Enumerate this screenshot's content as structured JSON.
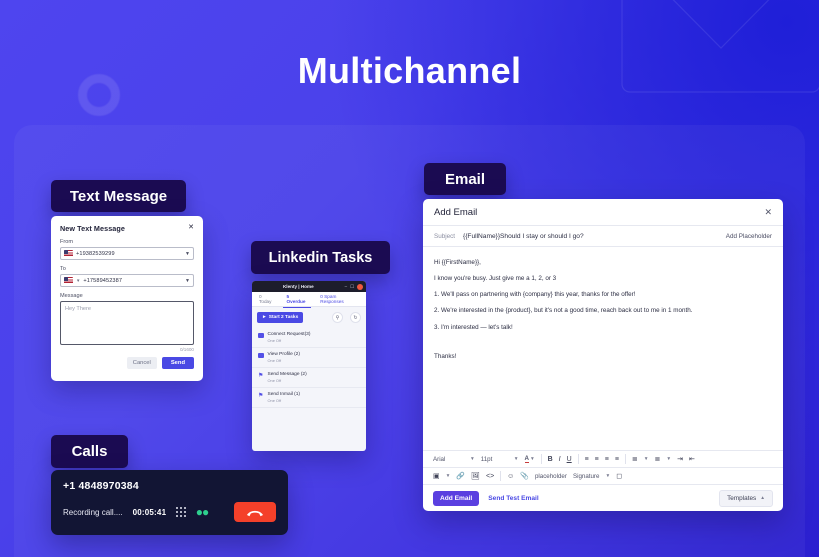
{
  "headline": "Multichannel",
  "tags": {
    "text_message": "Text Message",
    "linkedin": "Linkedin Tasks",
    "email": "Email",
    "calls": "Calls"
  },
  "sms_card": {
    "title": "New Text Message",
    "close_icon": "close-icon",
    "from_label": "From",
    "from_value": "+19382539299",
    "to_label": "To",
    "to_value": "+17589452387",
    "message_label": "Message",
    "message_placeholder": "Hey There",
    "char_count": "0/1600",
    "cancel_label": "Cancel",
    "send_label": "Send"
  },
  "linkedin_window": {
    "title": "Klenty | Home",
    "minimize_label": "–",
    "maximize_label": "☐",
    "tabs": [
      {
        "label": "0 Today",
        "active": false
      },
      {
        "label": "5 Overdue",
        "active": true
      },
      {
        "label": "0 Spam Responses",
        "active": false
      }
    ],
    "start_button": "Start 2 Tasks",
    "search_icon": "search-icon",
    "refresh_icon": "refresh-icon",
    "tasks": [
      {
        "name": "Connect Request(3)",
        "sub": "One Off",
        "icon": "connect-request-icon"
      },
      {
        "name": "View Profile (2)",
        "sub": "One Off",
        "icon": "view-profile-icon"
      },
      {
        "name": "Send Message (2)",
        "sub": "One Off",
        "icon": "send-message-icon"
      },
      {
        "name": "Send Inmail (1)",
        "sub": "One Off",
        "icon": "send-inmail-icon"
      }
    ]
  },
  "calls": {
    "number": "+1 4848970384",
    "status": "Recording call....",
    "timer": "00:05:41",
    "keypad_icon": "keypad-icon",
    "voicemail_icon": "voicemail-icon",
    "hangup_icon": "hangup-icon"
  },
  "email": {
    "title": "Add Email",
    "close_icon": "close-icon",
    "subject_label": "Subject",
    "subject_value": "{{FullName}}Should I stay or should I go?",
    "add_placeholder": "Add Placeholder",
    "body": {
      "greeting": "Hi {{FirstName}},",
      "intro": "I know you're busy. Just give me a 1, 2, or 3",
      "item1": "1. We'll pass on partnering with {company} this year, thanks for the offer!",
      "item2": "2. We're interested in the {product}, but it's not a good time, reach back out to me in 1 month.",
      "item3": "3. I'm interested — let's talk!",
      "signoff": "Thanks!"
    },
    "toolbar_row1": {
      "font_family": "Arial",
      "font_size": "11pt",
      "text_color_icon": "text-color-icon",
      "bold": "B",
      "italic": "I",
      "underline": "U",
      "align_left_icon": "align-left-icon",
      "align_center_icon": "align-center-icon",
      "align_justify_icon": "align-justify-icon",
      "align_right_icon": "align-right-icon",
      "bullet_list_icon": "bullet-list-icon",
      "numbered_list_icon": "numbered-list-icon",
      "outdent_icon": "outdent-icon",
      "indent_icon": "indent-icon"
    },
    "toolbar_row2": {
      "table_icon": "table-icon",
      "link_icon": "link-icon",
      "image_icon": "image-icon",
      "code_icon": "code-icon",
      "emoji_icon": "emoji-icon",
      "attachment_icon": "attachment-icon",
      "placeholder_label": "placeholder",
      "signature_label": "Signature",
      "video_icon": "video-icon"
    },
    "footer": {
      "add_email": "Add Email",
      "send_test_email": "Send Test Email",
      "templates": "Templates",
      "templates_caret": "▲"
    }
  }
}
